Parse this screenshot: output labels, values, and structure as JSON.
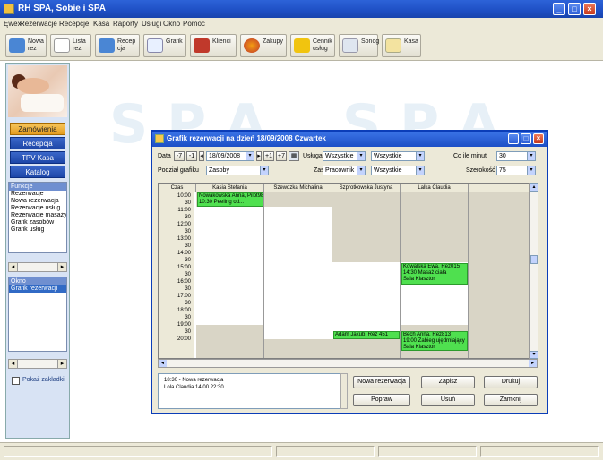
{
  "window": {
    "title": "RH SPA, Sobie i SPA"
  },
  "menu": [
    "Ęwex",
    "Rezerwacje",
    "Recepcje",
    "Kasa",
    "Raporty",
    "Usługi",
    "Okno",
    "Pomoc"
  ],
  "toolbar": [
    {
      "label": "Nowa\nrez",
      "icon": "people-icon",
      "color": "#4a86d4"
    },
    {
      "label": "Lista\nrez",
      "icon": "list-icon",
      "color": "#ffffff"
    },
    {
      "label": "Recep\ncja",
      "icon": "people-icon",
      "color": "#4a86d4"
    },
    {
      "label": "Grafik",
      "icon": "calendar-icon",
      "color": "#e8f0ff"
    },
    {
      "label": "Klienci",
      "icon": "clients-icon",
      "color": "#c0392b"
    },
    {
      "label": "Zakupy",
      "icon": "shopping-icon",
      "color": "#e67e22"
    },
    {
      "label": "Cennik\nusług",
      "icon": "price-tag-icon",
      "color": "#f1c40f"
    },
    {
      "label": "Sonog",
      "icon": "note-icon",
      "color": "#dfe6f0"
    },
    {
      "label": "Kasa",
      "icon": "cash-icon",
      "color": "#f3e3a0"
    }
  ],
  "sidebar": {
    "buttons": [
      "Zamówienia",
      "Recepcja",
      "TPV Kasa",
      "Katalog"
    ],
    "list1_header": "Funkcje",
    "list1_items": [
      "Rezerwacje",
      "Nowa rezerwacja",
      "Rezerwacje usług",
      "Rezerwacje masaży",
      "Grafik zasobów",
      "Grafik usług"
    ],
    "list2_header": "Okno",
    "list2_items": [
      "Grafik rezerwacji"
    ],
    "checkbox_label": "Pokaż zakładki"
  },
  "watermark": [
    "S P A",
    "S P A"
  ],
  "dialog": {
    "title": "Grafik rezerwacji na dzień 18/09/2008 Czwartek",
    "date_label": "Data",
    "date_value": "18/09/2008",
    "nav_prev2": "-7",
    "nav_prev": "-1",
    "nav_next": "+1",
    "nav_next2": "+7",
    "usluga_label": "Usługa",
    "usluga_value": "Wszystkie",
    "usluga2_value": "Wszystkie",
    "czas_label": "Co ile minut",
    "czas_value": "30",
    "podzial_label": "Podział grafiku",
    "podzial_value": "Zasoby",
    "zasob_label": "Zasób",
    "zasob_value": "Pracownik",
    "zasob2_value": "Wszystkie",
    "szerokosc_label": "Szerokość",
    "szerokosc_value": "75",
    "columns": [
      "Czas",
      "Kasia Stefania",
      "Szewdzka Michalina",
      "Szprotkowska Justyna",
      "Lalka Claudia"
    ],
    "times": [
      "10:00",
      "30",
      "11:00",
      "30",
      "12:00",
      "30",
      "13:00",
      "30",
      "14:00",
      "30",
      "15:00",
      "30",
      "16:00",
      "30",
      "17:00",
      "30",
      "18:00",
      "30",
      "19:00",
      "30",
      "20:00"
    ],
    "appointments": [
      {
        "text": "Nowakowska Anna, Pilot987..\n10:30 Peeling od..."
      },
      {
        "text": "Kowalska Ewa, Rez015\n14:30 Masaż ciała\nSala Klasztor"
      },
      {
        "text": "Adam Jakub, Rez 451"
      },
      {
        "text": "Bech Anna, Rez813\n19:00 Zabieg ujędrniający\nSala Klasztor"
      }
    ],
    "notes": "18:30 - Nowa rezerwacja\nLola Claudia 14:00 22:30",
    "buttons": {
      "nowa": "Nowa rezerwacja",
      "popraw": "Popraw",
      "zapisz": "Zapisz",
      "usun": "Usuń",
      "druk": "Drukuj",
      "zamknij": "Zamknij"
    }
  },
  "colors": {
    "titlebar": "#1e4fc4",
    "appointment": "#4fe04f",
    "sidebar_button": "#1d47a8",
    "sidebar_active": "#e39d21"
  }
}
